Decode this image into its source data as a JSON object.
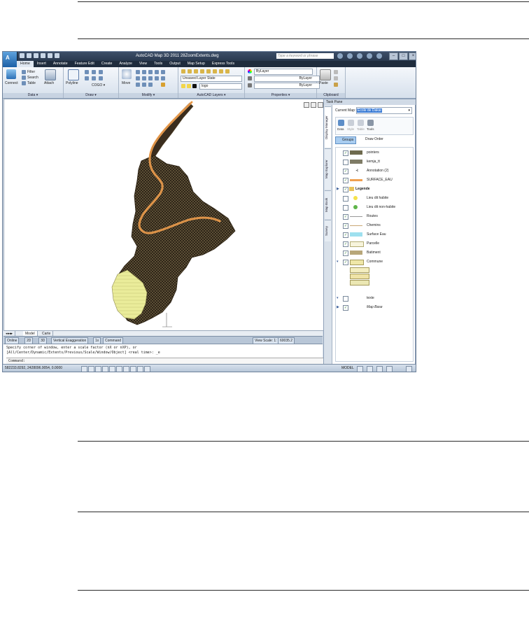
{
  "app": {
    "title": "AutoCAD Map 3D 2011    28ZoomExtents.dwg",
    "search_placeholder": "Type a keyword or phrase",
    "logo_letter": "A"
  },
  "ribbon": {
    "tabs": [
      "Home",
      "Insert",
      "Annotate",
      "Feature Edit",
      "Create",
      "Analyze",
      "View",
      "Tools",
      "Output",
      "Map Setup",
      "Express Tools"
    ],
    "active_tab": "Home",
    "data_group": {
      "title": "Data ▾",
      "connect": "Connect",
      "filter": "Filter",
      "search": "Search",
      "table": "Table",
      "attach": "Attach"
    },
    "draw_group": {
      "title": "Draw ▾",
      "polyline": "Polyline",
      "cogo": "COGO ▾"
    },
    "modify_group": {
      "title": "Modify ▾",
      "move": "Move"
    },
    "layers_group": {
      "title": "AutoCAD Layers ▾",
      "layer_state": "Unsaved Layer State",
      "layer": "logo"
    },
    "properties_group": {
      "title": "Properties ▾",
      "color": "ByLayer",
      "linetype": "ByLayer",
      "lineweight": "ByLayer"
    },
    "clipboard_group": {
      "title": "Clipboard",
      "paste": "Paste"
    }
  },
  "layout_tabs": [
    "Model",
    "Carte"
  ],
  "status_strip": {
    "online": "Online",
    "two_d": "2D",
    "three_d": "3D",
    "vertical": "Vertical Exaggeration",
    "vx_value": "1x",
    "command": "Command",
    "view_scale_label": "View Scale: 1:",
    "view_scale_value": "60035.2"
  },
  "command_line": {
    "line1": "Specify corner of window, enter a scale factor (nX or nXP), or",
    "line2": "[All/Center/Dynamic/Extents/Previous/Scale/Window/Object] <real time>: _e",
    "prompt": "Command:"
  },
  "statusbar": {
    "coords": "582233.8292, 2428096.9054, 0.0000",
    "model": "MODEL"
  },
  "task_pane": {
    "title": "Task Pane",
    "side_tabs": [
      "Display Manager",
      "Map Explorer",
      "Map Book",
      "Survey"
    ],
    "current_map_label": "Current Map:",
    "current_map_value": "Ecole de Dakar",
    "tools": [
      "Data",
      "Style",
      "Table",
      "Tools"
    ],
    "groups_btn": "Groups",
    "draw_order_btn": "Draw Order",
    "layers": [
      {
        "label": "pointers",
        "checked": true
      },
      {
        "label": "kemja_tt",
        "checked": false
      },
      {
        "label": "Annotation (2)",
        "checked": true
      },
      {
        "label": "SURFACE_EAU",
        "checked": true
      },
      {
        "label": "Legende",
        "checked": true
      },
      {
        "label": "Lieu dit habite",
        "checked": false
      },
      {
        "label": "Lieu dit non-habite",
        "checked": false
      },
      {
        "label": "Routes",
        "checked": true
      },
      {
        "label": "Chemins",
        "checked": true
      },
      {
        "label": "Surface Eau",
        "checked": true
      },
      {
        "label": "Parcelle",
        "checked": true
      },
      {
        "label": "Batiment",
        "checked": true
      },
      {
        "label": "Commune",
        "checked": true
      },
      {
        "label": "texte",
        "checked": false
      },
      {
        "label": "Map Base",
        "checked": true
      }
    ]
  },
  "colors": {
    "title_bar": "#2a394f",
    "ribbon": "#dfe7f1",
    "water": "#f0a050",
    "urban": "#3a2d1e",
    "parcel": "#eaec9a"
  }
}
